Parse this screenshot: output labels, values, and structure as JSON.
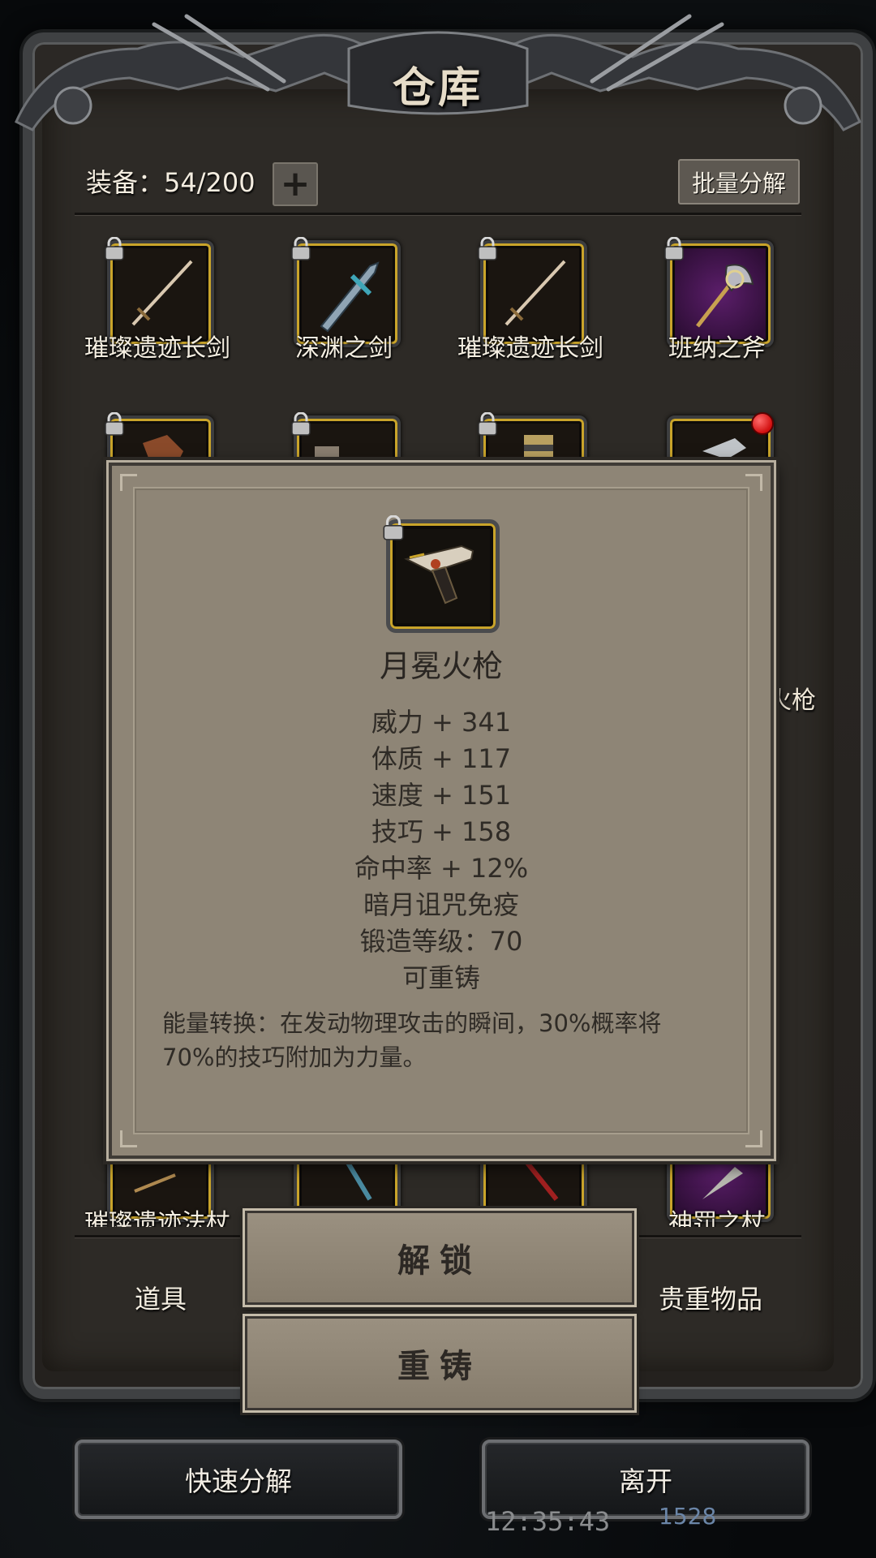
{
  "warehouse": {
    "title": "仓库",
    "capacity_label": "装备：54/200",
    "expand_symbol": "+",
    "batch_dismantle": "批量分解"
  },
  "items_row1": [
    {
      "name": "璀璨遗迹长剑",
      "icon": "longsword-icon"
    },
    {
      "name": "深渊之剑",
      "icon": "abyss-sword-icon"
    },
    {
      "name": "璀璨遗迹长剑",
      "icon": "longsword-icon"
    },
    {
      "name": "班纳之斧",
      "icon": "axe-icon"
    }
  ],
  "items_row_bottom": [
    {
      "name": "璀璨遗迹法杖"
    },
    {
      "name": "神罚之杖"
    }
  ],
  "side_peek": {
    "right_gun": "火枪"
  },
  "tabs": {
    "items": "道具",
    "valuables": "贵重物品"
  },
  "detail": {
    "name": "月冕火枪",
    "stats": [
      "威力 + 341",
      "体质 + 117",
      "速度 + 151",
      "技巧 + 158",
      "命中率 + 12%",
      "暗月诅咒免疫",
      "锻造等级：70",
      "可重铸"
    ],
    "description_line1": "能量转换：在发动物理攻击的瞬间，30%概率将",
    "description_line2": "70%的技巧附加为力量。"
  },
  "actions": {
    "unlock": "解锁",
    "reforge": "重铸"
  },
  "bottom": {
    "quick_dismantle": "快速分解",
    "leave": "离开"
  },
  "status": {
    "time": "12:35:43",
    "gems": "1528"
  },
  "colors": {
    "popup_bg": "#8e8576",
    "slot_gold": "#c9a42a",
    "frame_metal": "#3f4143"
  }
}
